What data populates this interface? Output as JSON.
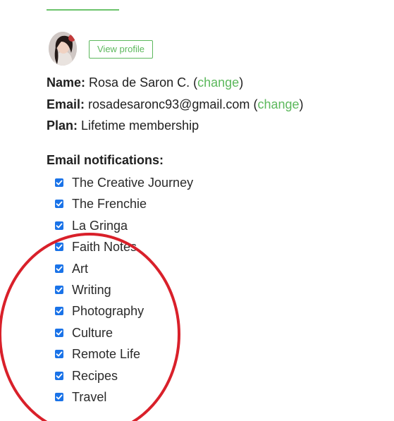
{
  "profile": {
    "view_profile_label": "View profile",
    "avatar_icon": "user-photo"
  },
  "account": {
    "name_label": "Name:",
    "name_value": "Rosa de Saron C.",
    "email_label": "Email:",
    "email_value": "rosadesaronc93@gmail.com",
    "plan_label": "Plan:",
    "plan_value": "Lifetime membership",
    "change_label": "change",
    "open_paren": "(",
    "close_paren": ")"
  },
  "notifications": {
    "title": "Email notifications:",
    "items": [
      {
        "label": "The Creative Journey",
        "checked": true
      },
      {
        "label": "The Frenchie",
        "checked": true
      },
      {
        "label": "La Gringa",
        "checked": true
      },
      {
        "label": "Faith Notes",
        "checked": true
      },
      {
        "label": "Art",
        "checked": true
      },
      {
        "label": "Writing",
        "checked": true
      },
      {
        "label": "Photography",
        "checked": true
      },
      {
        "label": "Culture",
        "checked": true
      },
      {
        "label": "Remote Life",
        "checked": true
      },
      {
        "label": "Recipes",
        "checked": true
      },
      {
        "label": "Travel",
        "checked": true
      }
    ]
  },
  "colors": {
    "accent": "#5cb85c",
    "checkbox": "#1a73e8",
    "annotation": "#d9202a"
  }
}
